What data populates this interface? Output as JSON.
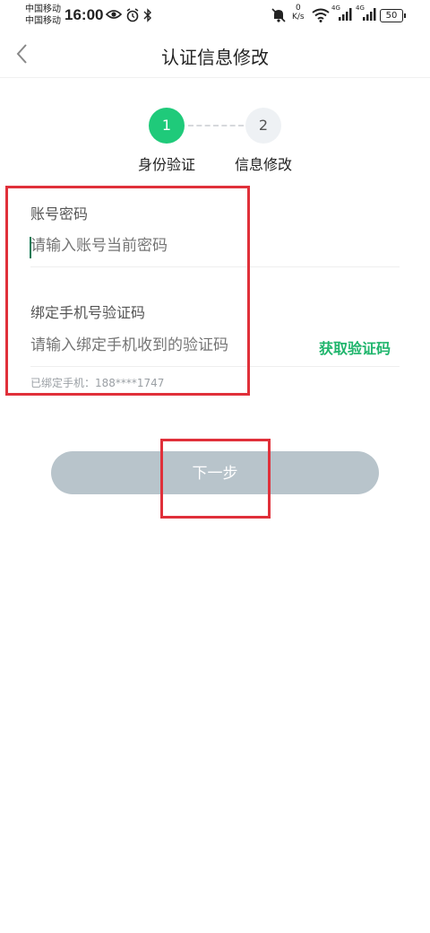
{
  "status_bar": {
    "carrier1": "中国移动",
    "carrier2": "中国移动",
    "time": "16:00",
    "net_speed_value": "0",
    "net_speed_unit": "K/s",
    "signal1_tag": "4G",
    "signal2_tag": "4G",
    "battery": "50"
  },
  "nav": {
    "title": "认证信息修改"
  },
  "stepper": {
    "steps": [
      {
        "number": "1",
        "label": "身份验证",
        "active": true
      },
      {
        "number": "2",
        "label": "信息修改",
        "active": false
      }
    ]
  },
  "form": {
    "password_label": "账号密码",
    "password_placeholder": "请输入账号当前密码",
    "sms_label": "绑定手机号验证码",
    "sms_placeholder": "请输入绑定手机收到的验证码",
    "get_code": "获取验证码",
    "bound_phone_hint": "已绑定手机：188****1747"
  },
  "next_button": "下一步",
  "colors": {
    "accent_green": "#1fca7a",
    "link_green": "#1fb56c",
    "button_disabled": "#b8c4cb",
    "highlight_red": "#e0303a"
  }
}
